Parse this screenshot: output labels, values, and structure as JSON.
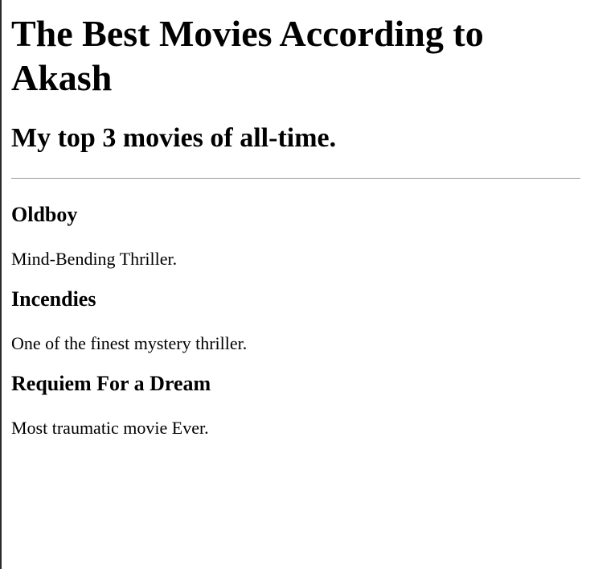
{
  "page": {
    "title": "The Best Movies According to Akash",
    "subtitle": "My top 3 movies of all-time."
  },
  "movies": [
    {
      "title": "Oldboy",
      "description": "Mind-Bending Thriller."
    },
    {
      "title": "Incendies",
      "description": "One of the finest mystery thriller."
    },
    {
      "title": "Requiem For a Dream",
      "description": "Most traumatic movie Ever."
    }
  ]
}
